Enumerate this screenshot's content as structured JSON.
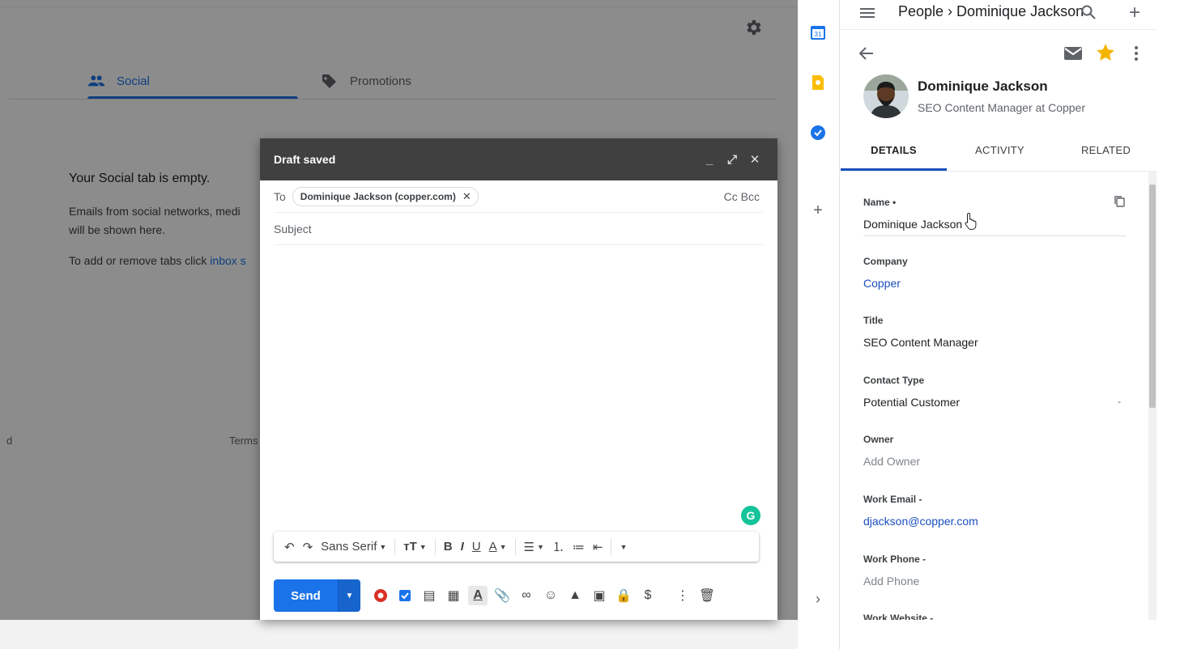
{
  "gmail": {
    "tabs": [
      {
        "label": "Social"
      },
      {
        "label": "Promotions"
      }
    ],
    "empty_title": "Your Social tab is empty.",
    "empty_line1": "Emails from social networks, medi",
    "empty_line2": "will be shown here.",
    "empty_line3_prefix": "To add or remove tabs click ",
    "empty_line3_link": "inbox s",
    "footer_left": "d",
    "footer_terms": "Terms"
  },
  "compose": {
    "header_title": "Draft saved",
    "to_label": "To",
    "recipient_chip": "Dominique Jackson (copper.com)",
    "cc_bcc": "Cc Bcc",
    "subject_placeholder": "Subject",
    "font_name": "Sans Serif",
    "send_label": "Send",
    "grammarly_letter": "G"
  },
  "panel": {
    "breadcrumb": "People › Dominique Jackson",
    "person_name": "Dominique Jackson",
    "person_title": "SEO Content Manager at Copper",
    "tabs": [
      {
        "label": "DETAILS"
      },
      {
        "label": "ACTIVITY"
      },
      {
        "label": "RELATED"
      }
    ],
    "fields": [
      {
        "label": "Name •",
        "value": "Dominique Jackson"
      },
      {
        "label": "Company",
        "value": "Copper"
      },
      {
        "label": "Title",
        "value": "SEO Content Manager"
      },
      {
        "label": "Contact Type",
        "value": "Potential Customer"
      },
      {
        "label": "Owner",
        "value": "Add Owner"
      },
      {
        "label": "Work Email -",
        "value": "djackson@copper.com"
      },
      {
        "label": "Work Phone -",
        "value": "Add Phone"
      },
      {
        "label": "Work Website -",
        "value": ""
      }
    ],
    "contact_type_dash": "-"
  },
  "side": {
    "calendar_day": "31"
  },
  "colors": {
    "gmail_blue": "#1a73e8",
    "copper_blue": "#1a4ebd",
    "star": "#f4b400",
    "compose_header": "#404040"
  }
}
